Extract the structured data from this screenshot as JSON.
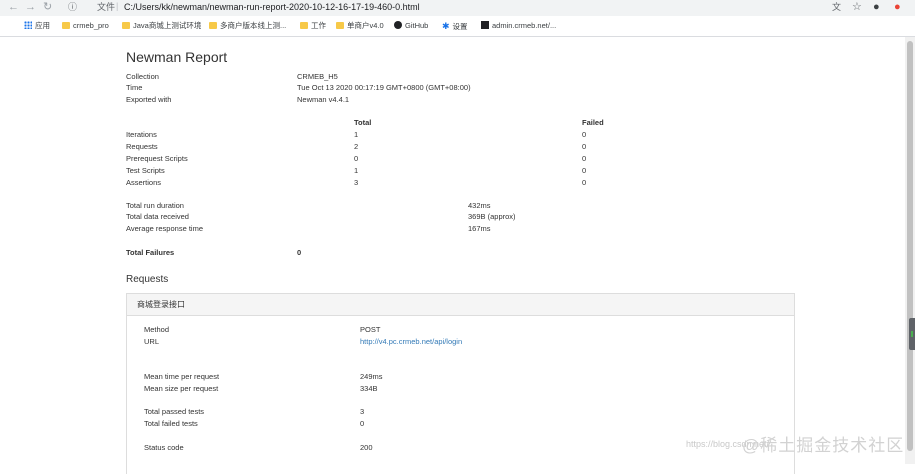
{
  "browser": {
    "url_label": "文件",
    "url": "C:/Users/kk/newman/newman-run-report-2020-10-12-16-17-19-460-0.html",
    "bookmarks": [
      "应用",
      "crmeb_pro",
      "Java商城上测试环境",
      "多商户版本线上测...",
      "工作",
      "单商户v4.0",
      "GitHub",
      "设置",
      "admin.crmeb.net/..."
    ]
  },
  "report": {
    "title": "Newman Report",
    "summary": [
      {
        "label": "Collection",
        "value": "CRMEB_H5"
      },
      {
        "label": "Time",
        "value": "Tue Oct 13 2020 00:17:19 GMT+0800 (GMT+08:00)"
      },
      {
        "label": "Exported with",
        "value": "Newman v4.4.1"
      }
    ],
    "stats_headers": {
      "total": "Total",
      "failed": "Failed"
    },
    "stats": [
      {
        "label": "Iterations",
        "total": "1",
        "failed": "0"
      },
      {
        "label": "Requests",
        "total": "2",
        "failed": "0"
      },
      {
        "label": "Prerequest Scripts",
        "total": "0",
        "failed": "0"
      },
      {
        "label": "Test Scripts",
        "total": "1",
        "failed": "0"
      },
      {
        "label": "Assertions",
        "total": "3",
        "failed": "0"
      }
    ],
    "timings": [
      {
        "label": "Total run duration",
        "value": "432ms"
      },
      {
        "label": "Total data received",
        "value": "369B (approx)"
      },
      {
        "label": "Average response time",
        "value": "167ms"
      }
    ],
    "failures_label": "Total Failures",
    "failures_value": "0",
    "requests_title": "Requests",
    "request": {
      "name": "商城登录接口",
      "rows": [
        {
          "label": "Method",
          "value": "POST"
        },
        {
          "label": "URL",
          "value": "http://v4.pc.crmeb.net/api/login"
        },
        {
          "label": "Mean time per request",
          "value": "249ms"
        },
        {
          "label": "Mean size per request",
          "value": "334B"
        },
        {
          "label": "Total passed tests",
          "value": "3"
        },
        {
          "label": "Total failed tests",
          "value": "0"
        },
        {
          "label": "Status code",
          "value": "200"
        }
      ]
    }
  },
  "watermark": {
    "prefix": "https://blog.csdn.net/",
    "brand": "@稀土掘金技术社区"
  }
}
